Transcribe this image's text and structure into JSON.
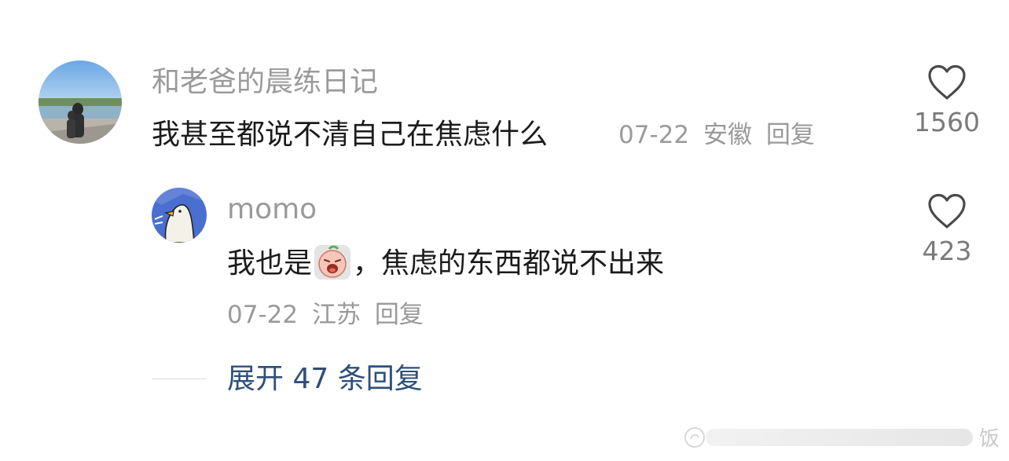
{
  "comment": {
    "username": "和老爸的晨练日记",
    "text": "我甚至都说不清自己在焦虑什么",
    "date": "07-22",
    "location": "安徽",
    "reply_label": "回复",
    "like_count": "1560"
  },
  "reply": {
    "username": "momo",
    "text_before": "我也是",
    "emoji": "crying-face-emoji",
    "text_after": "，焦虑的东西都说不出来",
    "date": "07-22",
    "location": "江苏",
    "reply_label": "回复",
    "like_count": "423"
  },
  "expand": {
    "label": "展开 47 条回复"
  },
  "watermark": {
    "text": "饭"
  },
  "colors": {
    "text": "#1b1b1b",
    "muted": "#9a9a9a",
    "link": "#2e4f7a",
    "heart_outline": "#4a4a4a"
  },
  "icons": {
    "like": "heart-outline-icon",
    "avatar_main": "father-son-lake-photo",
    "avatar_reply": "goose-cartoon-avatar"
  }
}
